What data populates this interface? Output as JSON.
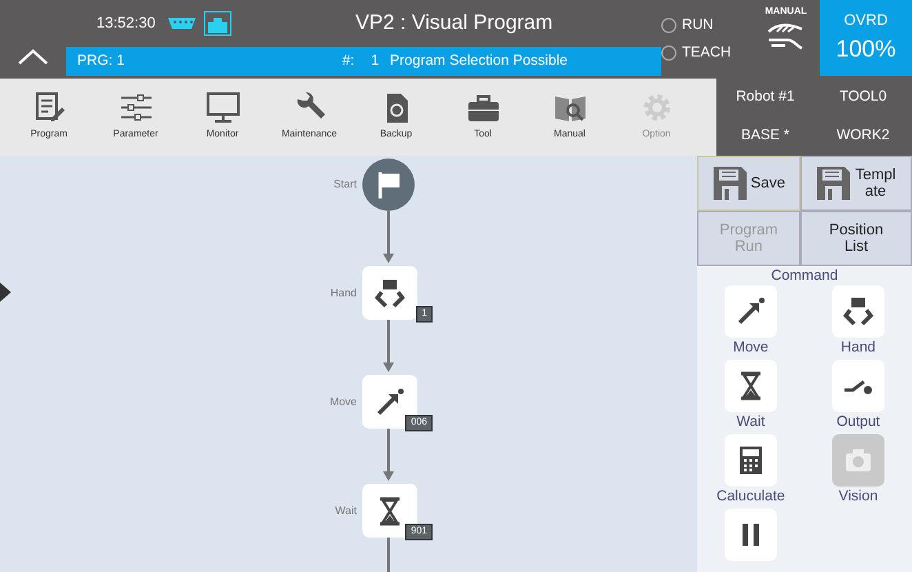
{
  "header": {
    "time": "13:52:30",
    "title": "VP2 : Visual Program",
    "program": "PRG: 1",
    "step_label": "#:",
    "step": "1",
    "message": "Program Selection Possible",
    "lamps": [
      {
        "label": "RUN",
        "on": false
      },
      {
        "label": "TEACH",
        "on": false
      }
    ],
    "mode": "MANUAL",
    "override_label": "OVRD",
    "override": "100%"
  },
  "toolbar": [
    {
      "kind": "program",
      "label": "Program",
      "disabled": false
    },
    {
      "kind": "parameter",
      "label": "Parameter",
      "disabled": false
    },
    {
      "kind": "monitor",
      "label": "Monitor",
      "disabled": false
    },
    {
      "kind": "maintenance",
      "label": "Maintenance",
      "disabled": false
    },
    {
      "kind": "backup",
      "label": "Backup",
      "disabled": false
    },
    {
      "kind": "tool",
      "label": "Tool",
      "disabled": false
    },
    {
      "kind": "manual",
      "label": "Manual",
      "disabled": false
    },
    {
      "kind": "option",
      "label": "Option",
      "disabled": true
    }
  ],
  "robot_info": [
    "Robot #1",
    "TOOL0",
    "BASE *",
    "WORK2"
  ],
  "flow": [
    {
      "kind": "start",
      "label": "Start"
    },
    {
      "kind": "hand",
      "label": "Hand",
      "badge": "1"
    },
    {
      "kind": "move",
      "label": "Move",
      "badge": "006"
    },
    {
      "kind": "wait",
      "label": "Wait",
      "badge": "901"
    }
  ],
  "actions": [
    {
      "kind": "save",
      "label": "Save",
      "selected": true,
      "disabled": false
    },
    {
      "kind": "save",
      "label": "Template",
      "selected": false,
      "disabled": false
    },
    {
      "kind": "text",
      "label": "Program Run",
      "selected": false,
      "disabled": true
    },
    {
      "kind": "text",
      "label": "Position List",
      "selected": false,
      "disabled": false
    }
  ],
  "command_heading": "Command",
  "commands": [
    {
      "kind": "move",
      "label": "Move",
      "disabled": false
    },
    {
      "kind": "hand",
      "label": "Hand",
      "disabled": false
    },
    {
      "kind": "wait",
      "label": "Wait",
      "disabled": false
    },
    {
      "kind": "output",
      "label": "Output",
      "disabled": false
    },
    {
      "kind": "calculate",
      "label": "Caluculate",
      "disabled": false
    },
    {
      "kind": "vision",
      "label": "Vision",
      "disabled": true
    },
    {
      "kind": "pause",
      "disabled": false
    }
  ]
}
